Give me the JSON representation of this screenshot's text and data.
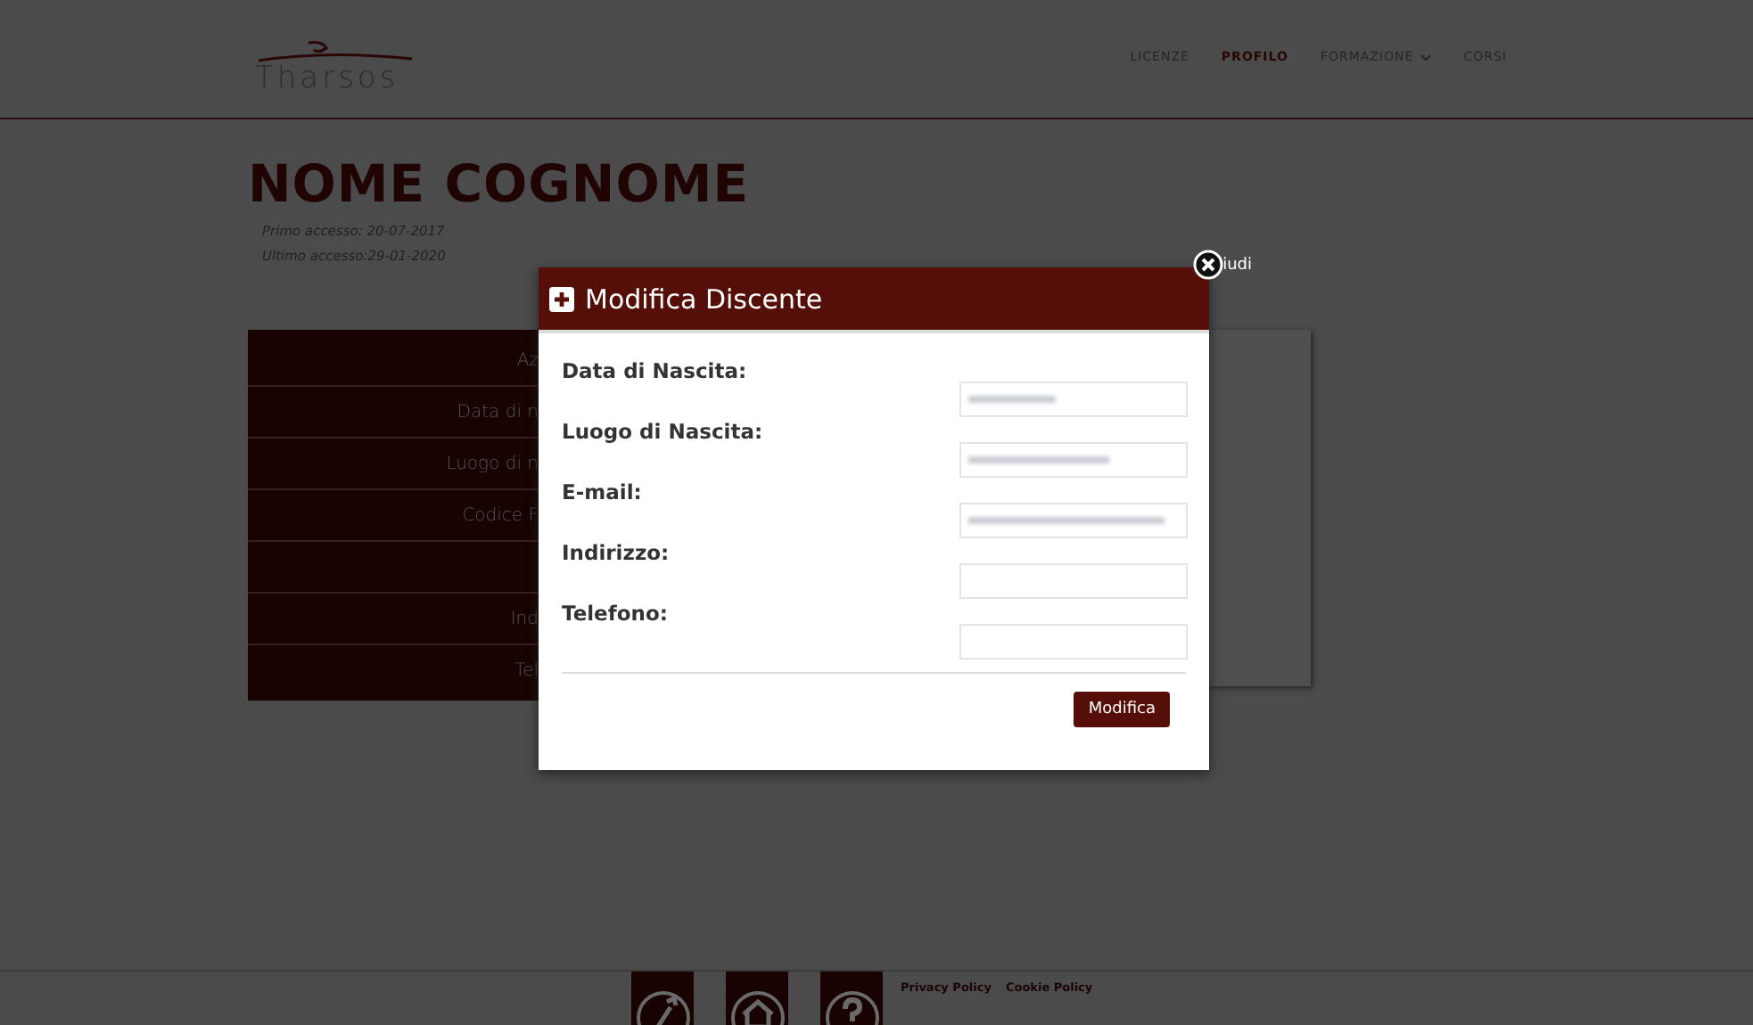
{
  "header": {
    "logo": "Tharsos",
    "nav": [
      {
        "label": "LICENZE",
        "selected": false,
        "dropdown": false
      },
      {
        "label": "PROFILO",
        "selected": true,
        "dropdown": false
      },
      {
        "label": "FORMAZIONE",
        "selected": false,
        "dropdown": true
      },
      {
        "label": "CORSI",
        "selected": false,
        "dropdown": false
      }
    ]
  },
  "profile": {
    "name": "NOME COGNOME",
    "first_access": "Primo accesso: 20-07-2017",
    "last_access": "Ultimo accesso:29-01-2020"
  },
  "info_rows": [
    "Az",
    "Data di n",
    "Luogo di n",
    "Codice F",
    "",
    "Ind",
    "Tel"
  ],
  "modal": {
    "title": "Modifica Discente",
    "close_label": "iudi",
    "fields": [
      {
        "label": "Data di Nascita:",
        "redacted": true
      },
      {
        "label": "Luogo di Nascita:",
        "redacted": true
      },
      {
        "label": "E-mail:",
        "redacted": true
      },
      {
        "label": "Indirizzo:",
        "redacted": false
      },
      {
        "label": "Telefono:",
        "redacted": false
      }
    ],
    "submit": "Modifica"
  },
  "footer": {
    "icons": [
      {
        "kind": "wrench"
      },
      {
        "kind": "home"
      },
      {
        "kind": "help"
      }
    ],
    "links": [
      "Privacy Policy",
      "Cookie Policy"
    ]
  }
}
